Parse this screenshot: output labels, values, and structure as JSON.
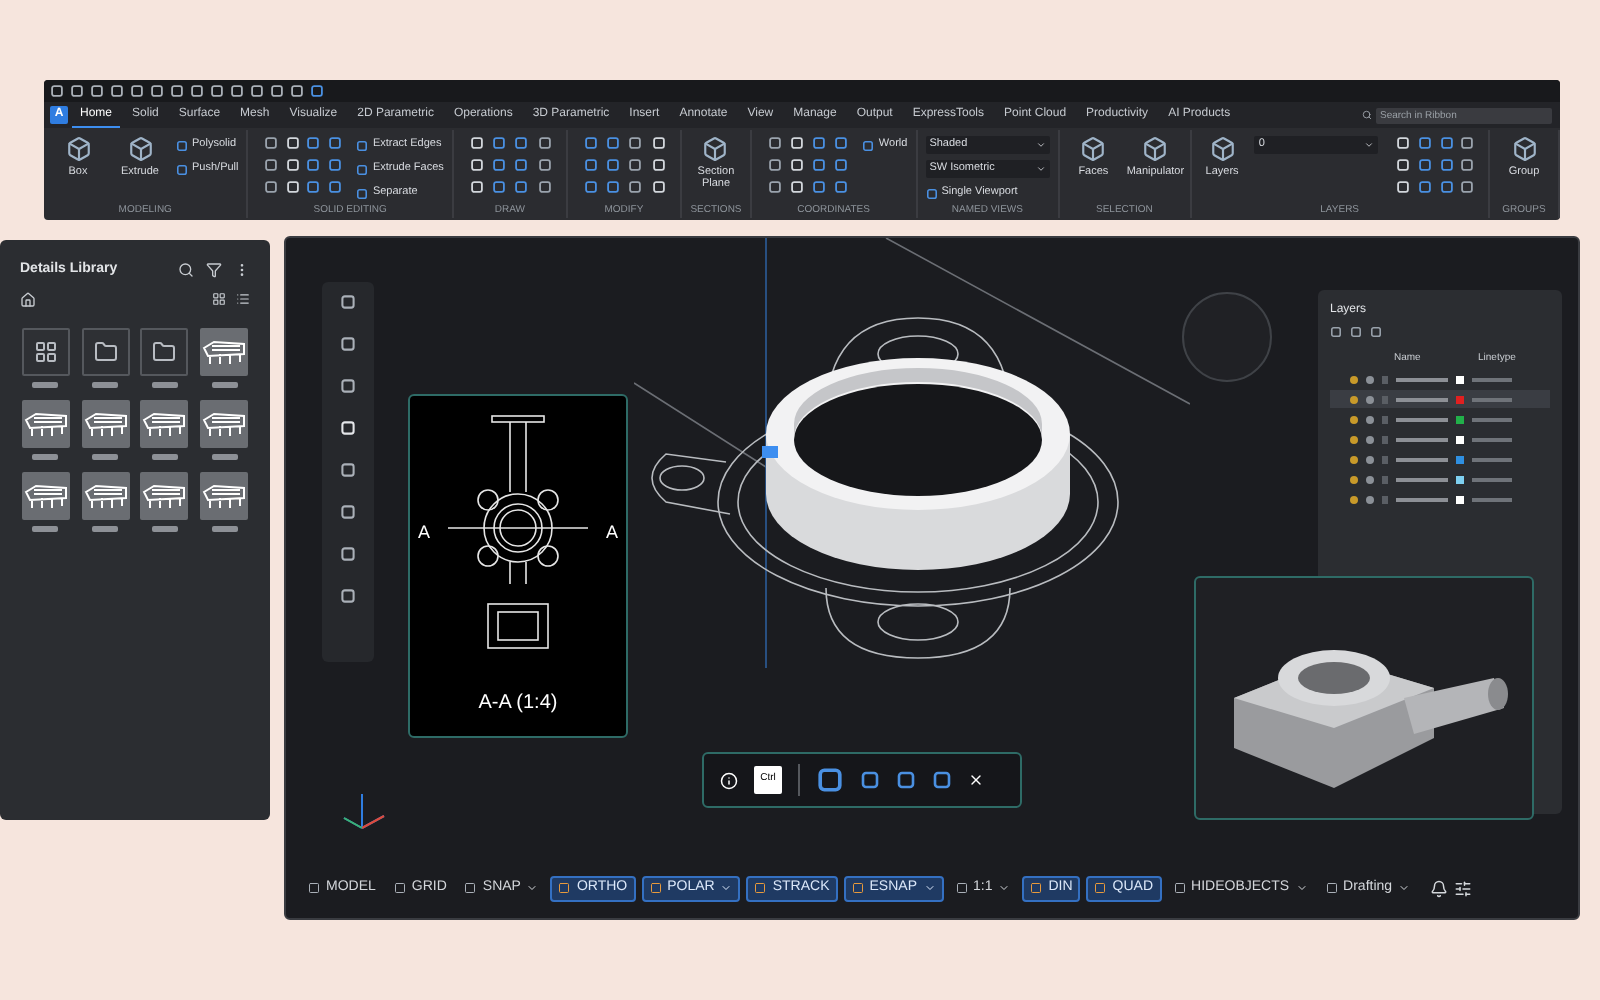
{
  "ribbon": {
    "logo": "A",
    "tabs": [
      {
        "label": "Home",
        "selected": true
      },
      {
        "label": "Solid",
        "selected": false
      },
      {
        "label": "Surface",
        "selected": false
      },
      {
        "label": "Mesh",
        "selected": false
      },
      {
        "label": "Visualize",
        "selected": false
      },
      {
        "label": "2D Parametric",
        "selected": false
      },
      {
        "label": "Operations",
        "selected": false
      },
      {
        "label": "3D Parametric",
        "selected": false
      },
      {
        "label": "Insert",
        "selected": false
      },
      {
        "label": "Annotate",
        "selected": false
      },
      {
        "label": "View",
        "selected": false
      },
      {
        "label": "Manage",
        "selected": false
      },
      {
        "label": "Output",
        "selected": false
      },
      {
        "label": "ExpressTools",
        "selected": false
      },
      {
        "label": "Point Cloud",
        "selected": false
      },
      {
        "label": "Productivity",
        "selected": false
      },
      {
        "label": "AI Products",
        "selected": false
      }
    ],
    "search": {
      "placeholder": "Search in Ribbon"
    },
    "panels": [
      {
        "title": "MODELING",
        "items": [
          {
            "kind": "large",
            "label": "Box"
          },
          {
            "kind": "large",
            "label": "Extrude"
          },
          {
            "kind": "small",
            "label": "Polysolid"
          },
          {
            "kind": "small",
            "label": "Push/Pull"
          }
        ]
      },
      {
        "title": "SOLID EDITING",
        "items": [
          {
            "kind": "icons"
          },
          {
            "kind": "small",
            "label": "Extract Edges"
          },
          {
            "kind": "small",
            "label": "Extrude Faces"
          },
          {
            "kind": "small",
            "label": "Separate"
          }
        ]
      },
      {
        "title": "DRAW",
        "items": [
          {
            "kind": "icons"
          }
        ]
      },
      {
        "title": "MODIFY",
        "items": [
          {
            "kind": "icons"
          }
        ]
      },
      {
        "title": "SECTIONS",
        "items": [
          {
            "kind": "large",
            "label": "Section Plane"
          }
        ]
      },
      {
        "title": "COORDINATES",
        "items": [
          {
            "kind": "icons"
          },
          {
            "kind": "small",
            "label": "World"
          }
        ]
      },
      {
        "title": "NAMED VIEWS",
        "items": [
          {
            "kind": "select",
            "label": "Shaded"
          },
          {
            "kind": "select",
            "label": "SW Isometric"
          },
          {
            "kind": "small",
            "label": "Single Viewport"
          }
        ]
      },
      {
        "title": "SELECTION",
        "items": [
          {
            "kind": "large",
            "label": "Faces"
          },
          {
            "kind": "large",
            "label": "Manipulator"
          }
        ]
      },
      {
        "title": "LAYERS",
        "items": [
          {
            "kind": "large",
            "label": "Layers"
          },
          {
            "kind": "select",
            "label": "0"
          },
          {
            "kind": "icons"
          }
        ]
      },
      {
        "title": "GROUPS",
        "items": [
          {
            "kind": "large",
            "label": "Group"
          }
        ]
      }
    ]
  },
  "library": {
    "title": "Details Library",
    "tiles": [
      {
        "kind": "grid"
      },
      {
        "kind": "folder"
      },
      {
        "kind": "folder"
      },
      {
        "kind": "drawing"
      },
      {
        "kind": "drawing"
      },
      {
        "kind": "drawing"
      },
      {
        "kind": "drawing"
      },
      {
        "kind": "drawing"
      },
      {
        "kind": "drawing"
      },
      {
        "kind": "drawing"
      },
      {
        "kind": "drawing"
      },
      {
        "kind": "drawing"
      }
    ]
  },
  "viewport": {
    "section_view": {
      "caption": "A-A (1:4)",
      "marks": [
        "A",
        "A"
      ]
    },
    "toolbar": {
      "key": "Ctrl"
    },
    "layers": {
      "title": "Layers",
      "columns": [
        "Name",
        "Linetype"
      ],
      "rows": [
        {
          "color": "#ffffff",
          "selected": false
        },
        {
          "color": "#e02020",
          "selected": true
        },
        {
          "color": "#22b04a",
          "selected": false
        },
        {
          "color": "#ffffff",
          "selected": false
        },
        {
          "color": "#2f8fe0",
          "selected": false
        },
        {
          "color": "#7fd0f0",
          "selected": false
        },
        {
          "color": "#ffffff",
          "selected": false
        }
      ]
    }
  },
  "status_bar": [
    {
      "label": "MODEL",
      "on": false,
      "dropdown": false
    },
    {
      "label": "GRID",
      "on": false,
      "dropdown": false
    },
    {
      "label": "SNAP",
      "on": false,
      "dropdown": true
    },
    {
      "label": "ORTHO",
      "on": true,
      "dropdown": false
    },
    {
      "label": "POLAR",
      "on": true,
      "dropdown": true
    },
    {
      "label": "STRACK",
      "on": true,
      "dropdown": false
    },
    {
      "label": "ESNAP",
      "on": true,
      "dropdown": true
    },
    {
      "label": "1:1",
      "on": false,
      "dropdown": true
    },
    {
      "label": "DIN",
      "on": true,
      "dropdown": false
    },
    {
      "label": "QUAD",
      "on": true,
      "dropdown": false
    },
    {
      "label": "HIDEOBJECTS",
      "on": false,
      "dropdown": true
    },
    {
      "label": "Drafting",
      "on": false,
      "dropdown": true
    }
  ]
}
